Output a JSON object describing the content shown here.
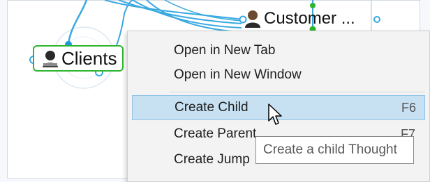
{
  "nodes": {
    "clients": {
      "label": "Clients",
      "icon": "person-icon"
    },
    "customer": {
      "label": "Customer ...",
      "icon": "person-icon"
    }
  },
  "context_menu": {
    "items": [
      {
        "label": "Open in New Tab",
        "shortcut": ""
      },
      {
        "label": "Open in New Window",
        "shortcut": ""
      },
      {
        "label": "Create Child",
        "shortcut": "F6",
        "selected": true
      },
      {
        "label": "Create Parent",
        "shortcut": "F7"
      },
      {
        "label": "Create Jump",
        "shortcut": ""
      }
    ]
  },
  "tooltip": {
    "text": "Create a child Thought"
  },
  "colors": {
    "link": "#38a9e0",
    "node_border": "#2fb52f",
    "menu_selection": "#c7e0f2",
    "menu_background": "#f3f3f3"
  }
}
